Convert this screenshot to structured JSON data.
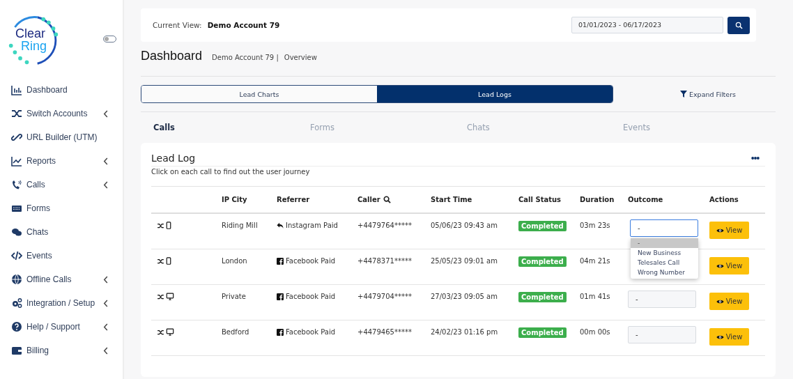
{
  "logo": {
    "line1": "Clear",
    "line2": "Ring"
  },
  "sidebar_toggle": {
    "on": false
  },
  "sidebar": {
    "items": [
      {
        "label": "Dashboard",
        "expandable": false
      },
      {
        "label": "Switch Accounts",
        "expandable": true
      },
      {
        "label": "URL Builder (UTM)",
        "expandable": false
      },
      {
        "label": "Reports",
        "expandable": true
      },
      {
        "label": "Calls",
        "expandable": true
      },
      {
        "label": "Forms",
        "expandable": false
      },
      {
        "label": "Chats",
        "expandable": false
      },
      {
        "label": "Events",
        "expandable": false
      },
      {
        "label": "Offline Calls",
        "expandable": true
      },
      {
        "label": "Integration / Setup",
        "expandable": true
      },
      {
        "label": "Help / Support",
        "expandable": true
      },
      {
        "label": "Billing",
        "expandable": true
      }
    ]
  },
  "header": {
    "label": "Current View:",
    "account": "Demo Account 79",
    "date_range": "01/01/2023 - 06/17/2023"
  },
  "page": {
    "title": "Dashboard",
    "breadcrumb": "Demo Account 79 |",
    "section": "Overview"
  },
  "view_tabs": [
    {
      "label": "Lead Charts",
      "selected": false
    },
    {
      "label": "Lead Logs",
      "selected": true
    }
  ],
  "expand_filters": "Expand Filters",
  "type_tabs": [
    {
      "label": "Calls",
      "selected": true
    },
    {
      "label": "Forms",
      "selected": false
    },
    {
      "label": "Chats",
      "selected": false
    },
    {
      "label": "Events",
      "selected": false
    }
  ],
  "lead_log": {
    "title": "Lead Log",
    "subtitle": "Click on each call to find out the user journey",
    "columns": [
      "",
      "IP City",
      "Referrer",
      "Caller",
      "Start Time",
      "Call Status",
      "Duration",
      "Outcome",
      "Actions"
    ],
    "rows": [
      {
        "device": {
          "kind": "mobile"
        },
        "city": "Riding Mill",
        "referrer": {
          "kind": "reply",
          "label": "Instagram Paid"
        },
        "caller": "+4479764*****",
        "start": "05/06/23 09:43 am",
        "status": "Completed",
        "duration": "03m 23s",
        "outcome": "-",
        "focused": true,
        "action": "View",
        "outcome_menu": [
          {
            "label": "-",
            "selected": true
          },
          {
            "label": "New Business",
            "selected": false
          },
          {
            "label": "Telesales Call",
            "selected": false
          },
          {
            "label": "Wrong Number",
            "selected": false
          }
        ]
      },
      {
        "device": {
          "kind": "mobile"
        },
        "city": "London",
        "referrer": {
          "kind": "facebook",
          "label": "Facebook Paid"
        },
        "caller": "+4478371*****",
        "start": "25/05/23 09:01 am",
        "status": "Completed",
        "duration": "04m 21s",
        "action": "View"
      },
      {
        "device": {
          "kind": "desktop"
        },
        "city": "Private",
        "referrer": {
          "kind": "facebook",
          "label": "Facebook Paid"
        },
        "caller": "+4479704*****",
        "start": "27/03/23 09:05 am",
        "status": "Completed",
        "duration": "01m 41s",
        "outcome": "-",
        "focused": false,
        "action": "View"
      },
      {
        "device": {
          "kind": "desktop"
        },
        "city": "Bedford",
        "referrer": {
          "kind": "facebook",
          "label": "Facebook Paid"
        },
        "caller": "+4479465*****",
        "start": "24/02/23 01:16 pm",
        "status": "Completed",
        "duration": "00m 00s",
        "outcome": "-",
        "focused": false,
        "action": "View"
      }
    ]
  }
}
